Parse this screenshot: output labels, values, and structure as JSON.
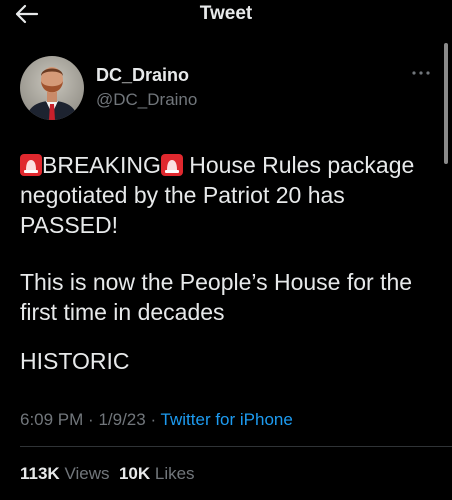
{
  "header": {
    "title": "Tweet",
    "back_icon": "arrow-left-icon"
  },
  "author": {
    "name": "DC_Draino",
    "handle": "@DC_Draino",
    "avatar_icon": "avatar"
  },
  "more_icon": "more-options-icon",
  "tweet": {
    "p1_a": "BREAKING",
    "p1_b": "House Rules package negotiated by the Patriot 20 has PASSED!",
    "p2": "This is now the People’s House for the first time in decades",
    "p3": "HISTORIC",
    "emoji_icon": "police-siren-icon"
  },
  "meta": {
    "time": "6:09 PM",
    "sep1": "·",
    "date": "1/9/23",
    "sep2": "·",
    "source": "Twitter for iPhone"
  },
  "stats": {
    "views_count": "113K",
    "views_label": "Views",
    "likes_count": "10K",
    "likes_label": "Likes"
  },
  "colors": {
    "background": "#000000",
    "text": "#e7e9ea",
    "secondary": "#71767b",
    "link": "#1d9bf0",
    "siren": "#e0282e"
  }
}
